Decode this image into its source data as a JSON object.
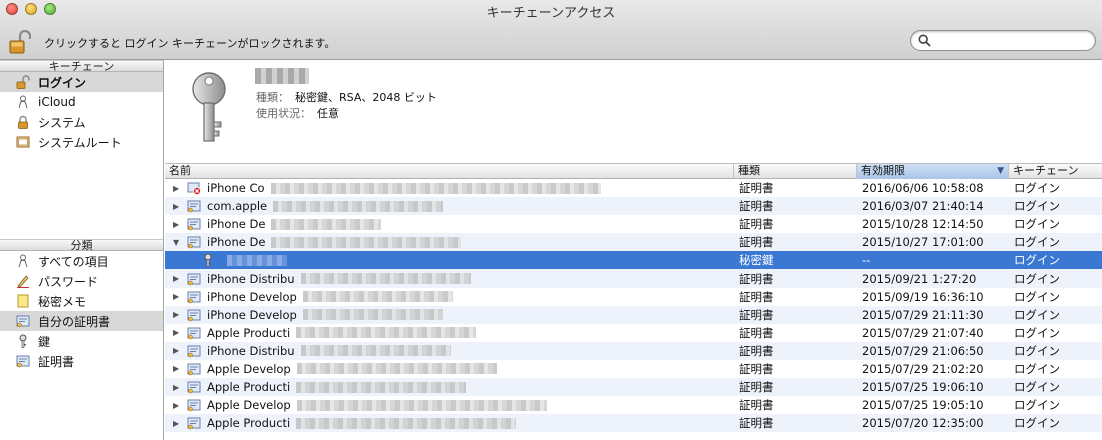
{
  "window": {
    "title": "キーチェーンアクセス"
  },
  "toolbar": {
    "lock_label": "クリックすると ログイン キーチェーンがロックされます。",
    "search_placeholder": ""
  },
  "sidebar": {
    "keychains_header": "キーチェーン",
    "keychains": [
      {
        "label": "ログイン",
        "icon": "lock-open-icon",
        "selected": true
      },
      {
        "label": "iCloud",
        "icon": "person-icon",
        "selected": false
      },
      {
        "label": "システム",
        "icon": "lock-icon",
        "selected": false
      },
      {
        "label": "システムルート",
        "icon": "folder-icon",
        "selected": false
      }
    ],
    "category_header": "分類",
    "categories": [
      {
        "label": "すべての項目",
        "icon": "all-items-icon",
        "selected": false
      },
      {
        "label": "パスワード",
        "icon": "pen-icon",
        "selected": false
      },
      {
        "label": "秘密メモ",
        "icon": "note-icon",
        "selected": false
      },
      {
        "label": "自分の証明書",
        "icon": "my-cert-icon",
        "selected": true
      },
      {
        "label": "鍵",
        "icon": "key-icon",
        "selected": false
      },
      {
        "label": "証明書",
        "icon": "certificate-icon",
        "selected": false
      }
    ]
  },
  "detail": {
    "kind_label": "種類：",
    "kind_value": "秘密鍵、RSA、2048 ビット",
    "usage_label": "使用状況：",
    "usage_value": "任意"
  },
  "table": {
    "columns": {
      "name": "名前",
      "kind": "種類",
      "expires": "有効期限",
      "keychain": "キーチェーン"
    },
    "rows": [
      {
        "name": "iPhone Co",
        "kind": "証明書",
        "expires": "2016/06/06 10:58:08",
        "keychain": "ログイン",
        "icon": "cert-invalid-icon",
        "disclosure": "▶"
      },
      {
        "name": "com.apple",
        "kind": "証明書",
        "expires": "2016/03/07 21:40:14",
        "keychain": "ログイン",
        "icon": "certificate-icon",
        "disclosure": "▶"
      },
      {
        "name": "iPhone De",
        "kind": "証明書",
        "expires": "2015/10/28 12:14:50",
        "keychain": "ログイン",
        "icon": "certificate-icon",
        "disclosure": "▶"
      },
      {
        "name": "iPhone De",
        "kind": "証明書",
        "expires": "2015/10/27 17:01:00",
        "keychain": "ログイン",
        "icon": "certificate-icon",
        "disclosure": "▼"
      },
      {
        "name": "",
        "kind": "秘密鍵",
        "expires": "--",
        "keychain": "ログイン",
        "icon": "key-icon",
        "disclosure": "",
        "selected": true,
        "child": true
      },
      {
        "name": "iPhone Distribu",
        "kind": "証明書",
        "expires": "2015/09/21 1:27:20",
        "keychain": "ログイン",
        "icon": "certificate-icon",
        "disclosure": "▶"
      },
      {
        "name": "iPhone Develop",
        "kind": "証明書",
        "expires": "2015/09/19 16:36:10",
        "keychain": "ログイン",
        "icon": "certificate-icon",
        "disclosure": "▶"
      },
      {
        "name": "iPhone Develop",
        "kind": "証明書",
        "expires": "2015/07/29 21:11:30",
        "keychain": "ログイン",
        "icon": "certificate-icon",
        "disclosure": "▶"
      },
      {
        "name": "Apple Producti",
        "kind": "証明書",
        "expires": "2015/07/29 21:07:40",
        "keychain": "ログイン",
        "icon": "certificate-icon",
        "disclosure": "▶"
      },
      {
        "name": "iPhone Distribu",
        "kind": "証明書",
        "expires": "2015/07/29 21:06:50",
        "keychain": "ログイン",
        "icon": "certificate-icon",
        "disclosure": "▶"
      },
      {
        "name": "Apple Develop",
        "kind": "証明書",
        "expires": "2015/07/29 21:02:20",
        "keychain": "ログイン",
        "icon": "certificate-icon",
        "disclosure": "▶"
      },
      {
        "name": "Apple Producti",
        "kind": "証明書",
        "expires": "2015/07/25 19:06:10",
        "keychain": "ログイン",
        "icon": "certificate-icon",
        "disclosure": "▶"
      },
      {
        "name": "Apple Develop",
        "kind": "証明書",
        "expires": "2015/07/25 19:05:10",
        "keychain": "ログイン",
        "icon": "certificate-icon",
        "disclosure": "▶"
      },
      {
        "name": "Apple Producti",
        "kind": "証明書",
        "expires": "2015/07/20 12:35:00",
        "keychain": "ログイン",
        "icon": "certificate-icon",
        "disclosure": "▶"
      }
    ]
  },
  "colors": {
    "selection": "#3b78d4",
    "sidebar_selection": "#d8d8d8",
    "row_stripe": "#eef3fb",
    "sort_header": "#a9c4e8"
  }
}
